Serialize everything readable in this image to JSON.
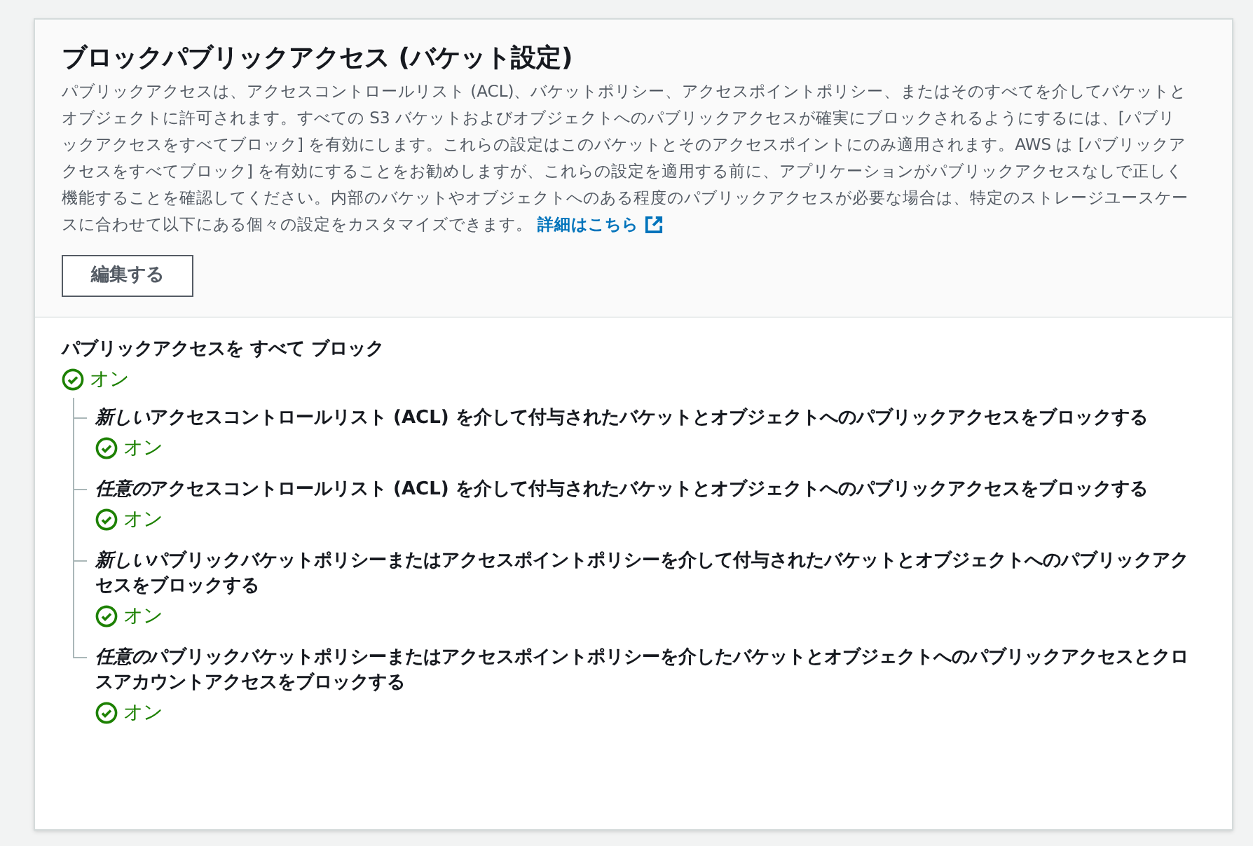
{
  "header": {
    "title": "ブロックパブリックアクセス (バケット設定)",
    "description": "パブリックアクセスは、アクセスコントロールリスト (ACL)、バケットポリシー、アクセスポイントポリシー、またはそのすべてを介してバケットとオブジェクトに許可されます。すべての S3 バケットおよびオブジェクトへのパブリックアクセスが確実にブロックされるようにするには、[パブリックアクセスをすべてブロック] を有効にします。これらの設定はこのバケットとそのアクセスポイントにのみ適用されます。AWS は [パブリックアクセスをすべてブロック] を有効にすることをお勧めしますが、これらの設定を適用する前に、アプリケーションがパブリックアクセスなしで正しく機能することを確認してください。内部のバケットやオブジェクトへのある程度のパブリックアクセスが必要な場合は、特定のストレージユースケースに合わせて以下にある個々の設定をカスタマイズできます。",
    "link": "詳細はこちら",
    "edit_button": "編集する"
  },
  "setting": {
    "label": "パブリックアクセスを すべて ブロック",
    "on": true,
    "status": "オン",
    "children": [
      {
        "label_emphasis": "新しい",
        "label": "アクセスコントロールリスト (ACL) を介して付与されたバケットとオブジェクトへのパブリックアクセスをブロックする",
        "on": true,
        "status": "オン"
      },
      {
        "label_emphasis": "任意の",
        "label": "アクセスコントロールリスト (ACL) を介して付与されたバケットとオブジェクトへのパブリックアクセスをブロックする",
        "on": true,
        "status": "オン"
      },
      {
        "label_emphasis": "新しい",
        "label": "パブリックバケットポリシーまたはアクセスポイントポリシーを介して付与されたバケットとオブジェクトへのパブリックアクセスをブロックする",
        "on": true,
        "status": "オン"
      },
      {
        "label_emphasis": "任意の",
        "label": "パブリックバケットポリシーまたはアクセスポイントポリシーを介したバケットとオブジェクトへのパブリックアクセスとクロスアカウントアクセスをブロックする",
        "on": true,
        "status": "オン"
      }
    ]
  }
}
